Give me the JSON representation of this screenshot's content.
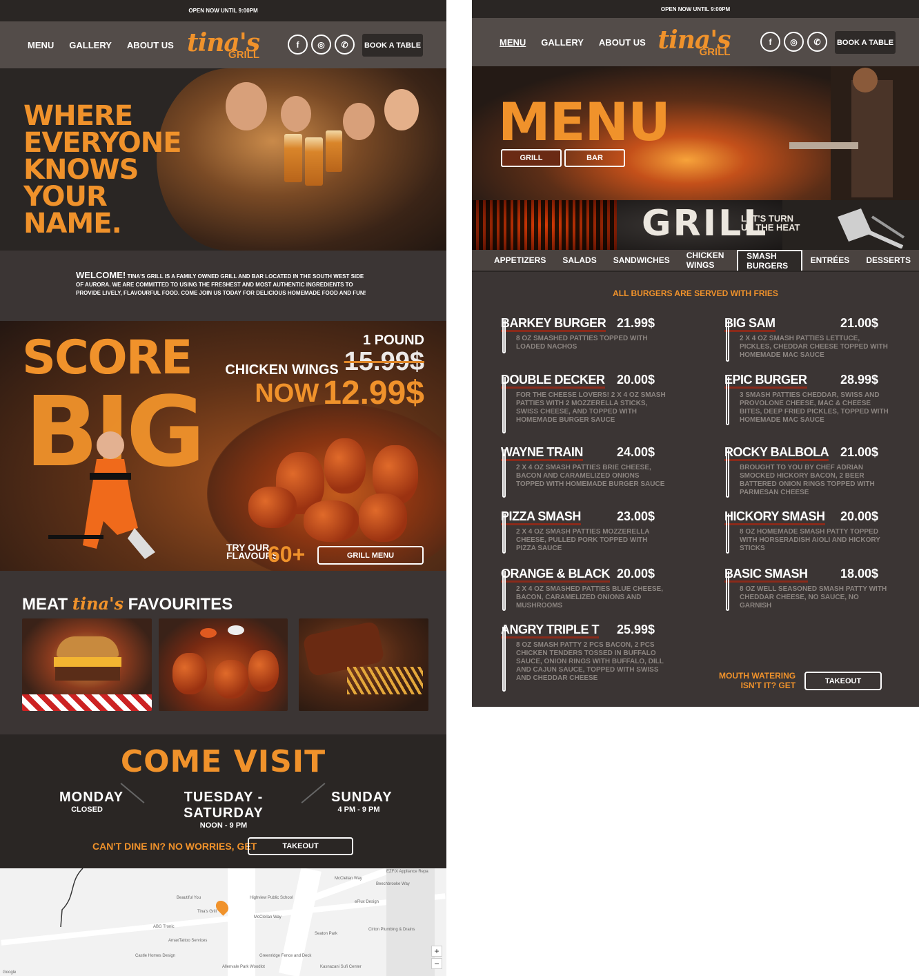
{
  "left": {
    "topbar": "OPEN NOW UNTIL 9:00PM",
    "nav": {
      "menu": "MENU",
      "gallery": "GALLERY",
      "about": "ABOUT US",
      "book": "BOOK A TABLE"
    },
    "logo": {
      "script": "tina's",
      "grill": "GRILL"
    },
    "social": {
      "facebook": "f",
      "instagram": "◎",
      "phone": "✆"
    },
    "hero_title": "WHERE EVERYONE KNOWS YOUR NAME.",
    "welcome": {
      "lead": "WELCOME!",
      "text": "TINA'S GRILL IS A FAMILY OWNED GRILL AND BAR LOCATED IN THE SOUTH WEST SIDE OF AURORA. WE ARE COMMITTED TO USING THE FRESHEST AND MOST AUTHENTIC INGREDIENTS TO PROVIDE LIVELY, FLAVOURFUL FOOD. COME JOIN US TODAY FOR DELICIOUS HOMEMADE FOOD AND FUN!"
    },
    "promo": {
      "score": "SCORE",
      "big": "BIG",
      "line1": "1 POUND",
      "line2": "CHICKEN WINGS",
      "old_price": "15.99$",
      "now": "NOW",
      "new_price": "12.99$",
      "try": "TRY OUR",
      "flavours": "FLAVOURS",
      "count": "60+",
      "button": "GRILL MENU"
    },
    "favourites": {
      "meat": "MEAT",
      "script": "tina's",
      "rest": "FAVOURITES"
    },
    "visit": {
      "title": "COME VISIT",
      "days": [
        {
          "day": "MONDAY",
          "hours": "CLOSED"
        },
        {
          "day": "TUESDAY - SATURDAY",
          "hours": "NOON - 9 PM"
        },
        {
          "day": "SUNDAY",
          "hours": "4 PM - 9 PM"
        }
      ],
      "dinein": "CAN'T DINE IN? NO WORRIES, GET",
      "takeout": "TAKEOUT"
    },
    "map": {
      "labels": [
        "EZFIX Appliance Repa",
        "Beechbrooke Way",
        "McClellan Way",
        "Highview Public School",
        "Beautiful You",
        "Tina's Grill",
        "eFlux Design",
        "McClellan Way",
        "ABG Tronic",
        "Seaton Park",
        "Cirton Plumbing & Drains",
        "AmaxTattoo Services",
        "Castle Homes Design",
        "Greenridge Fence and Deck",
        "Allenvale Park Woodlot",
        "Kasnazani Sufi Center",
        "Google"
      ],
      "zoom_in": "+",
      "zoom_out": "−"
    }
  },
  "right": {
    "topbar": "OPEN NOW UNTIL 9:00PM",
    "nav": {
      "menu": "MENU",
      "gallery": "GALLERY",
      "about": "ABOUT US",
      "book": "BOOK A TABLE"
    },
    "logo": {
      "script": "tina's",
      "grill": "GRILL"
    },
    "hero_title": "MENU",
    "tabs": {
      "grill": "GRILL",
      "bar": "BAR"
    },
    "band": {
      "title": "GRILL",
      "tag1": "LET'S TURN",
      "tag2": "UP THE HEAT"
    },
    "categories": [
      "APPETIZERS",
      "SALADS",
      "SANDWICHES",
      "CHICKEN WINGS",
      "SMASH BURGERS",
      "ENTRÉES",
      "DESSERTS"
    ],
    "served": "ALL BURGERS ARE SERVED WITH FRIES",
    "items": [
      {
        "name": "BARKEY BURGER",
        "price": "21.99$",
        "desc": "8 OZ SMASHED PATTIES TOPPED WITH LOADED NACHOS"
      },
      {
        "name": "BIG SAM",
        "price": "21.00$",
        "desc": "2 X 4 OZ SMASH PATTIES LETTUCE, PICKLES, CHEDDAR CHEESE TOPPED WITH HOMEMADE MAC SAUCE"
      },
      {
        "name": "DOUBLE DECKER",
        "price": "20.00$",
        "desc": "FOR THE CHEESE LOVERS! 2 X 4 OZ SMASH PATTIES WITH 2 MOZZERELLA STICKS, SWISS CHEESE, AND TOPPED WITH HOMEMADE BURGER SAUCE"
      },
      {
        "name": "EPIC BURGER",
        "price": "28.99$",
        "desc": "3 SMASH PATTIES CHEDDAR, SWISS AND PROVOLONE CHEESE, MAC & CHEESE BITES, DEEP FRIED PICKLES, TOPPED WITH HOMEMADE MAC SAUCE"
      },
      {
        "name": "WAYNE TRAIN",
        "price": "24.00$",
        "desc": "2 X 4 OZ SMASH PATTIES BRIE CHEESE, BACON AND CARAMELIZED ONIONS TOPPED WITH HOMEMADE BURGER SAUCE"
      },
      {
        "name": "ROCKY BALBOLA",
        "price": "21.00$",
        "desc": "BROUGHT TO YOU BY CHEF ADRIAN SMOCKED HICKORY BACON, 2 BEER BATTERED ONION RINGS TOPPED WITH PARMESAN CHEESE"
      },
      {
        "name": "PIZZA SMASH",
        "price": "23.00$",
        "desc": "2 X 4 OZ SMASH PATTIES MOZZERELLA CHEESE, PULLED PORK TOPPED WITH PIZZA SAUCE"
      },
      {
        "name": "HICKORY SMASH",
        "price": "20.00$",
        "desc": "8 OZ HOMEMADE SMASH PATTY TOPPED WITH HORSERADISH AIOLI AND HICKORY STICKS"
      },
      {
        "name": "ORANGE & BLACK",
        "price": "20.00$",
        "desc": "2 X 4 OZ SMASHED PATTIES BLUE CHEESE, BACON, CARAMELIZED ONIONS AND MUSHROOMS"
      },
      {
        "name": "BASIC SMASH",
        "price": "18.00$",
        "desc": "8 OZ WELL SEASONED SMASH PATTY WITH CHEDDAR CHEESE, NO SAUCE, NO GARNISH"
      },
      {
        "name": "ANGRY TRIPLE T",
        "price": "25.99$",
        "desc": "8 OZ SMASH PATTY 2 PCS BACON, 2 PCS CHICKEN TENDERS TOSSED IN BUFFALO SAUCE, ONION RINGS WITH BUFFALO, DILL AND CAJUN SAUCE, TOPPED WITH SWISS AND CHEDDAR CHEESE"
      }
    ],
    "mouth1": "MOUTH WATERING",
    "mouth2": "ISN'T IT? GET",
    "takeout": "TAKEOUT"
  },
  "colors": {
    "accent": "#f0922b",
    "bg": "#3b3534",
    "dark": "#2a2624",
    "nav": "#534c49"
  }
}
